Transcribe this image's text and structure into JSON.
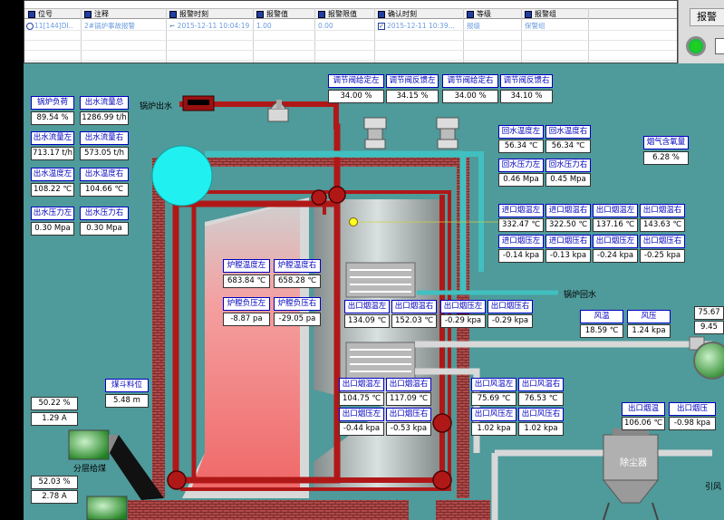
{
  "alarm_table": {
    "columns": [
      "位号",
      "注释",
      "报警时刻",
      "报警值",
      "报警限值",
      "确认时刻",
      "等级",
      "报警组"
    ],
    "row": [
      "11[144]DI..",
      "2#锅炉事故报警",
      "2015-12-11 10:04:19",
      "1.00",
      "0.00",
      "2015-12-11 10:39...",
      "报级",
      "保警组"
    ]
  },
  "right_panel": {
    "ack_label": "报警"
  },
  "boiler": {
    "outlet_label": "锅炉出水",
    "return_label": "锅炉回水",
    "coal_label": "分层给煤",
    "dust_label": "除尘器",
    "fan_label": "引风"
  },
  "left_panel": {
    "load": {
      "label": "锅炉负荷",
      "value": "89.54 %"
    },
    "flow": {
      "label": "出水流量总",
      "value": "1286.99 t/h"
    },
    "flow_l": {
      "label": "出水流量左",
      "value": "713.17 t/h"
    },
    "flow_r": {
      "label": "出水流量右",
      "value": "573.05 t/h"
    },
    "temp_l": {
      "label": "出水温度左",
      "value": "108.22 ℃"
    },
    "temp_r": {
      "label": "出水温度右",
      "value": "104.66 ℃"
    },
    "press_l": {
      "label": "出水压力左",
      "value": "0.30 Mpa"
    },
    "press_r": {
      "label": "出水压力右",
      "value": "0.30 Mpa"
    }
  },
  "valves": {
    "set_l": {
      "label": "调节阀给定左",
      "value": "34.00 %"
    },
    "fb_l": {
      "label": "调节阀反馈左",
      "value": "34.15 %"
    },
    "set_r": {
      "label": "调节阀给定右",
      "value": "34.00 %"
    },
    "fb_r": {
      "label": "调节阀反馈右",
      "value": "34.10 %"
    }
  },
  "return_water": {
    "temp_l": {
      "label": "回水温度左",
      "value": "56.34 ℃"
    },
    "temp_r": {
      "label": "回水温度右",
      "value": "56.34 ℃"
    },
    "press_l": {
      "label": "回水压力左",
      "value": "0.46 Mpa"
    },
    "press_r": {
      "label": "回水压力右",
      "value": "0.45 Mpa"
    }
  },
  "oxygen": {
    "label": "烟气含氧量",
    "value": "6.28 %"
  },
  "inlet_flue": {
    "t1": {
      "label": "进口烟温左",
      "value": "332.47 ℃"
    },
    "t2": {
      "label": "进口烟温右",
      "value": "322.50 ℃"
    },
    "t3": {
      "label": "出口烟温左",
      "value": "137.16 ℃"
    },
    "t4": {
      "label": "出口烟温右",
      "value": "143.63 ℃"
    },
    "p1": {
      "label": "进口烟压左",
      "value": "-0.14 kpa"
    },
    "p2": {
      "label": "进口烟压右",
      "value": "-0.13 kpa"
    },
    "p3": {
      "label": "出口烟压左",
      "value": "-0.24 kpa"
    },
    "p4": {
      "label": "出口烟压右",
      "value": "-0.25 kpa"
    }
  },
  "furnace": {
    "t_l": {
      "label": "炉膛温度左",
      "value": "683.84 ℃"
    },
    "t_r": {
      "label": "炉膛温度右",
      "value": "658.28 ℃"
    },
    "p_l": {
      "label": "炉膛负压左",
      "value": "-8.87 pa"
    },
    "p_r": {
      "label": "炉膛负压右",
      "value": "-29.05 pa"
    }
  },
  "economizer_mid": {
    "t_l": {
      "label": "出口烟温左",
      "value": "134.09 ℃"
    },
    "t_r": {
      "label": "出口烟温右",
      "value": "152.03 ℃"
    },
    "p_l": {
      "label": "出口烟压左",
      "value": "-0.29 kpa"
    },
    "p_r": {
      "label": "出口烟压右",
      "value": "-0.29 kpa"
    }
  },
  "air": {
    "temp": {
      "label": "风温",
      "value": "18.59 ℃"
    },
    "press": {
      "label": "风压",
      "value": "1.24 kpa"
    },
    "extra1": "75.67",
    "extra2": "9.45"
  },
  "lower_flue": {
    "t_l": {
      "label": "出口烟温左",
      "value": "104.75 ℃"
    },
    "t_r": {
      "label": "出口烟温右",
      "value": "117.09 ℃"
    },
    "p_l": {
      "label": "出口烟压左",
      "value": "-0.44 kpa"
    },
    "p_r": {
      "label": "出口烟压右",
      "value": "-0.53 kpa"
    }
  },
  "wind_out": {
    "t_l": {
      "label": "出口风温左",
      "value": "75.69 ℃"
    },
    "t_r": {
      "label": "出口风温右",
      "value": "76.53 ℃"
    },
    "p_l": {
      "label": "出口风压左",
      "value": "1.02 kpa"
    },
    "p_r": {
      "label": "出口风压右",
      "value": "1.02 kpa"
    }
  },
  "final_out": {
    "t": {
      "label": "出口烟温",
      "value": "106.06 ℃"
    },
    "p": {
      "label": "出口烟压",
      "value": "-0.98 kpa"
    }
  },
  "coal": {
    "label": "煤斗料位",
    "value": "5.48 m"
  },
  "feeders": {
    "f1_pct": "50.22 %",
    "f1_amp": "1.29 A",
    "f2_pct": "52.03 %",
    "f2_amp": "2.78 A"
  },
  "colors": {
    "water_pipe": "#b01818",
    "return_pipe": "#40c0c0",
    "brick": "#b04040",
    "furnace": "#f08888",
    "background": "#4f9a9a"
  }
}
